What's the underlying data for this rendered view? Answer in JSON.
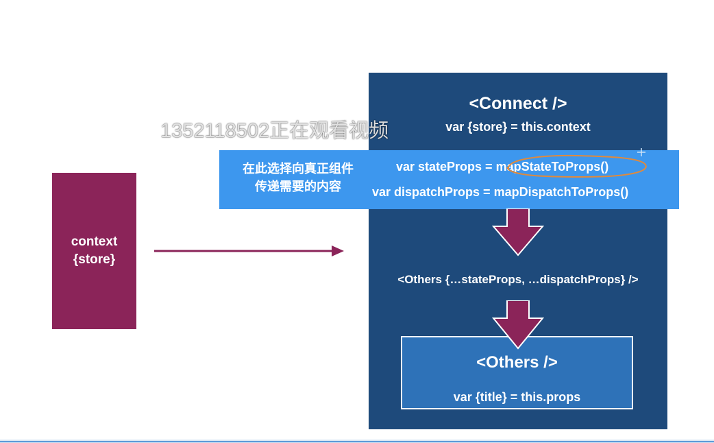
{
  "context_box": {
    "line1": "context",
    "line2": "{store}"
  },
  "connect": {
    "title": "<Connect />",
    "store_line": "var {store} = this.context"
  },
  "band": {
    "note_line1": "在此选择向真正组件",
    "note_line2": "传递需要的内容",
    "state_props": "var stateProps = mapStateToProps()",
    "dispatch_props": "var dispatchProps = mapDispatchToProps()"
  },
  "others_spread": "<Others {…stateProps, …dispatchProps} />",
  "others": {
    "title": "<Others />",
    "props_line": "var {title} = this.props"
  },
  "watermark": "1352118502正在观看视频",
  "colors": {
    "context_box": "#8b2459",
    "arrow": "#8b2459",
    "connect_panel": "#1e4a7b",
    "select_band": "#3d97ee",
    "others_box": "#2e72b8",
    "highlight_ellipse": "#e08a3c"
  }
}
